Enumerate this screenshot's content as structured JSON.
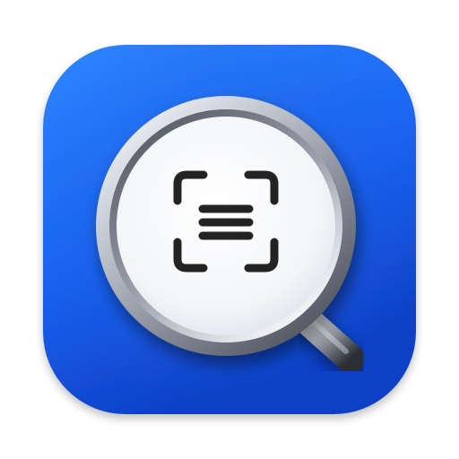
{
  "app_icon": {
    "icon": "text-scan-magnifier-icon",
    "colors": {
      "background_light": "#2f86ff",
      "background_mid": "#1a63f0",
      "background_dark": "#0d3fc4",
      "ring_light": "#e9ecf2",
      "ring_mid": "#9aa1ad",
      "ring_dark": "#4c525c",
      "lens": "#f8f9fb",
      "glyph": "#232323",
      "handle_light": "#b9bec6",
      "handle_dark": "#2c2f35"
    }
  }
}
